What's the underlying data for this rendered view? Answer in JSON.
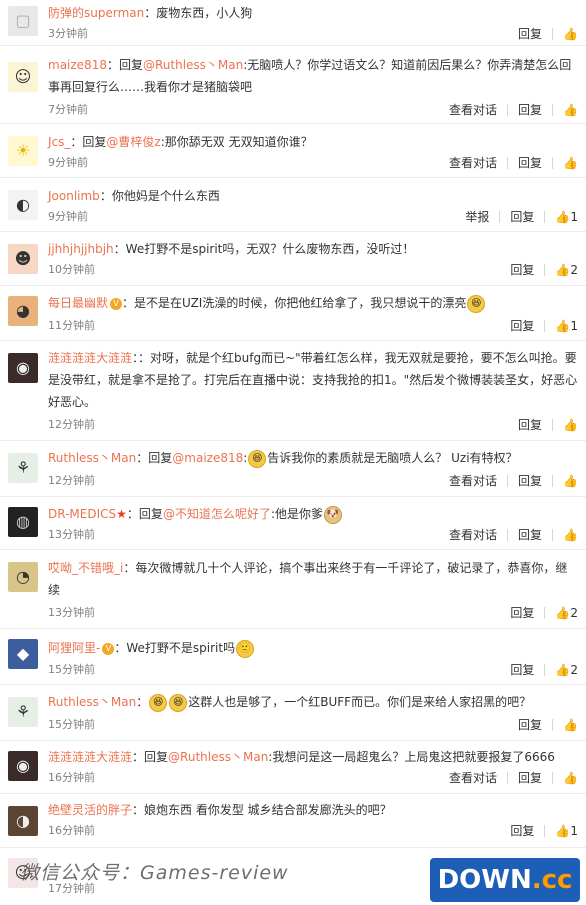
{
  "labels": {
    "reply": "回复",
    "view_dialog": "查看对话",
    "report": "举报",
    "reply_prefix": "回复"
  },
  "comments": [
    {
      "user": "防弹的superman",
      "text": "：废物东西，小人狗",
      "time": "3分钟前",
      "actions": [
        "reply"
      ],
      "likes": ""
    },
    {
      "user": "maize818",
      "reply_to": "@Ruthless丶Man",
      "text": ":无脑喷人？你学过语文么？知道前因后果么？你弄清楚怎么回事再回复行么……我看你才是猪脑袋吧",
      "time": "7分钟前",
      "actions": [
        "view_dialog",
        "reply"
      ],
      "likes": ""
    },
    {
      "user": "Jcs_",
      "reply_to": "@曹梓俊z",
      "text": ":那你舔无双 无双知道你谁？",
      "time": "9分钟前",
      "actions": [
        "view_dialog",
        "reply"
      ],
      "likes": ""
    },
    {
      "user": "Joonlimb",
      "text": "：你他妈是个什么东西",
      "time": "9分钟前",
      "actions": [
        "report",
        "reply"
      ],
      "likes": "1"
    },
    {
      "user": "jjhhjhjjhbjh",
      "text": "：We打野不是spirit吗，无双？什么废物东西，没听过！",
      "time": "10分钟前",
      "actions": [
        "reply"
      ],
      "likes": "2"
    },
    {
      "user": "每日最幽默",
      "text": "：是不是在UZI洗澡的时候，你把他红给拿了，我只想说干的漂亮",
      "time": "11分钟前",
      "actions": [
        "reply"
      ],
      "likes": "1"
    },
    {
      "user": "涟涟涟涟大涟涟",
      "text": "：对呀，就是个红bufg而已~\"带着红怎么样，我无双就是要抢，要不怎么叫抢。要是没带红，就是拿不是抢了。打完后在直播中说：支持我抢的扣1。\"然后发个微博装装圣女，好恶心好恶心。",
      "time": "12分钟前",
      "actions": [
        "reply"
      ],
      "likes": ""
    },
    {
      "user": "Ruthless丶Man",
      "reply_to": "@maize818",
      "text": "告诉我你的素质就是无脑喷人么？ Uzi有特权？",
      "time": "12分钟前",
      "actions": [
        "view_dialog",
        "reply"
      ],
      "likes": ""
    },
    {
      "user": "DR-MEDICS",
      "reply_to": "@不知道怎么呢好了",
      "text": ":他是你爹",
      "time": "13分钟前",
      "actions": [
        "view_dialog",
        "reply"
      ],
      "likes": ""
    },
    {
      "user": "哎呦_不错哦_i",
      "text": "：每次微博就几十个人评论，搞个事出来终于有一千评论了，破记录了，恭喜你，继续",
      "time": "13分钟前",
      "actions": [
        "reply"
      ],
      "likes": "2"
    },
    {
      "user": "阿狸阿里-",
      "text": "：We打野不是spirit吗",
      "time": "15分钟前",
      "actions": [
        "reply"
      ],
      "likes": "2"
    },
    {
      "user": "Ruthless丶Man",
      "text": "这群人也是够了，一个红BUFF而已。你们是来给人家招黑的吧？",
      "time": "15分钟前",
      "actions": [
        "reply"
      ],
      "likes": ""
    },
    {
      "user": "涟涟涟涟大涟涟",
      "reply_to": "@Ruthless丶Man",
      "text": ":我想问是这一局超鬼么？上局鬼这把就要报复了6666",
      "time": "16分钟前",
      "actions": [
        "view_dialog",
        "reply"
      ],
      "likes": ""
    },
    {
      "user": "绝壁灵活的胖子",
      "text": "：娘炮东西 看你发型 城乡结合部发廊洗头的吧？",
      "time": "16分钟前",
      "actions": [
        "reply"
      ],
      "likes": "1"
    },
    {
      "user": "",
      "text": "",
      "time": "17分钟前",
      "actions": [],
      "likes": ""
    }
  ],
  "watermark": "微信公众号：Games-review",
  "logo": {
    "main": "DOWN",
    "suffix": ".cc"
  }
}
